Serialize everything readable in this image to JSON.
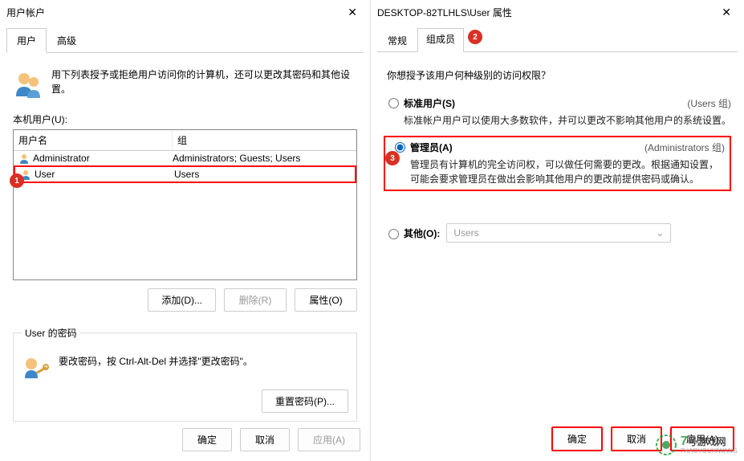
{
  "left": {
    "title": "用户帐户",
    "tabs": {
      "user": "用户",
      "advanced": "高级"
    },
    "intro": "用下列表授予或拒绝用户访问你的计算机，还可以更改其密码和其他设置。",
    "local_users_label": "本机用户(U):",
    "table": {
      "headers": {
        "name": "用户名",
        "group": "组"
      },
      "rows": [
        {
          "name": "Administrator",
          "group": "Administrators; Guests; Users"
        },
        {
          "name": "User",
          "group": "Users"
        }
      ]
    },
    "buttons": {
      "add": "添加(D)...",
      "remove": "删除(R)",
      "properties": "属性(O)"
    },
    "password_box": {
      "legend": "User 的密码",
      "text": "要改密码，按 Ctrl-Alt-Del 并选择\"更改密码\"。",
      "reset": "重置密码(P)..."
    },
    "dialog_buttons": {
      "ok": "确定",
      "cancel": "取消",
      "apply": "应用(A)"
    }
  },
  "right": {
    "title": "DESKTOP-82TLHLS\\User 属性",
    "tabs": {
      "general": "常规",
      "membership": "组成员"
    },
    "question": "你想授予该用户何种级别的访问权限？",
    "options": {
      "standard": {
        "title": "标准用户(S)",
        "hint": "(Users 组)",
        "desc": "标准帐户用户可以使用大多数软件，并可以更改不影响其他用户的系统设置。"
      },
      "admin": {
        "title": "管理员(A)",
        "hint": "(Administrators 组)",
        "desc": "管理员有计算机的完全访问权，可以做任何需要的更改。根据通知设置，可能会要求管理员在做出会影响其他用户的更改前提供密码或确认。"
      },
      "other": {
        "title": "其他(O):",
        "dropdown": "Users"
      }
    },
    "dialog_buttons": {
      "ok": "确定",
      "cancel": "取消",
      "apply": "应用(A)"
    }
  },
  "badges": {
    "b1": "1",
    "b2": "2",
    "b3": "3"
  },
  "watermark": {
    "num": "7",
    "text": "号游戏网",
    "sub": "7HAOYOUXIWANG"
  }
}
